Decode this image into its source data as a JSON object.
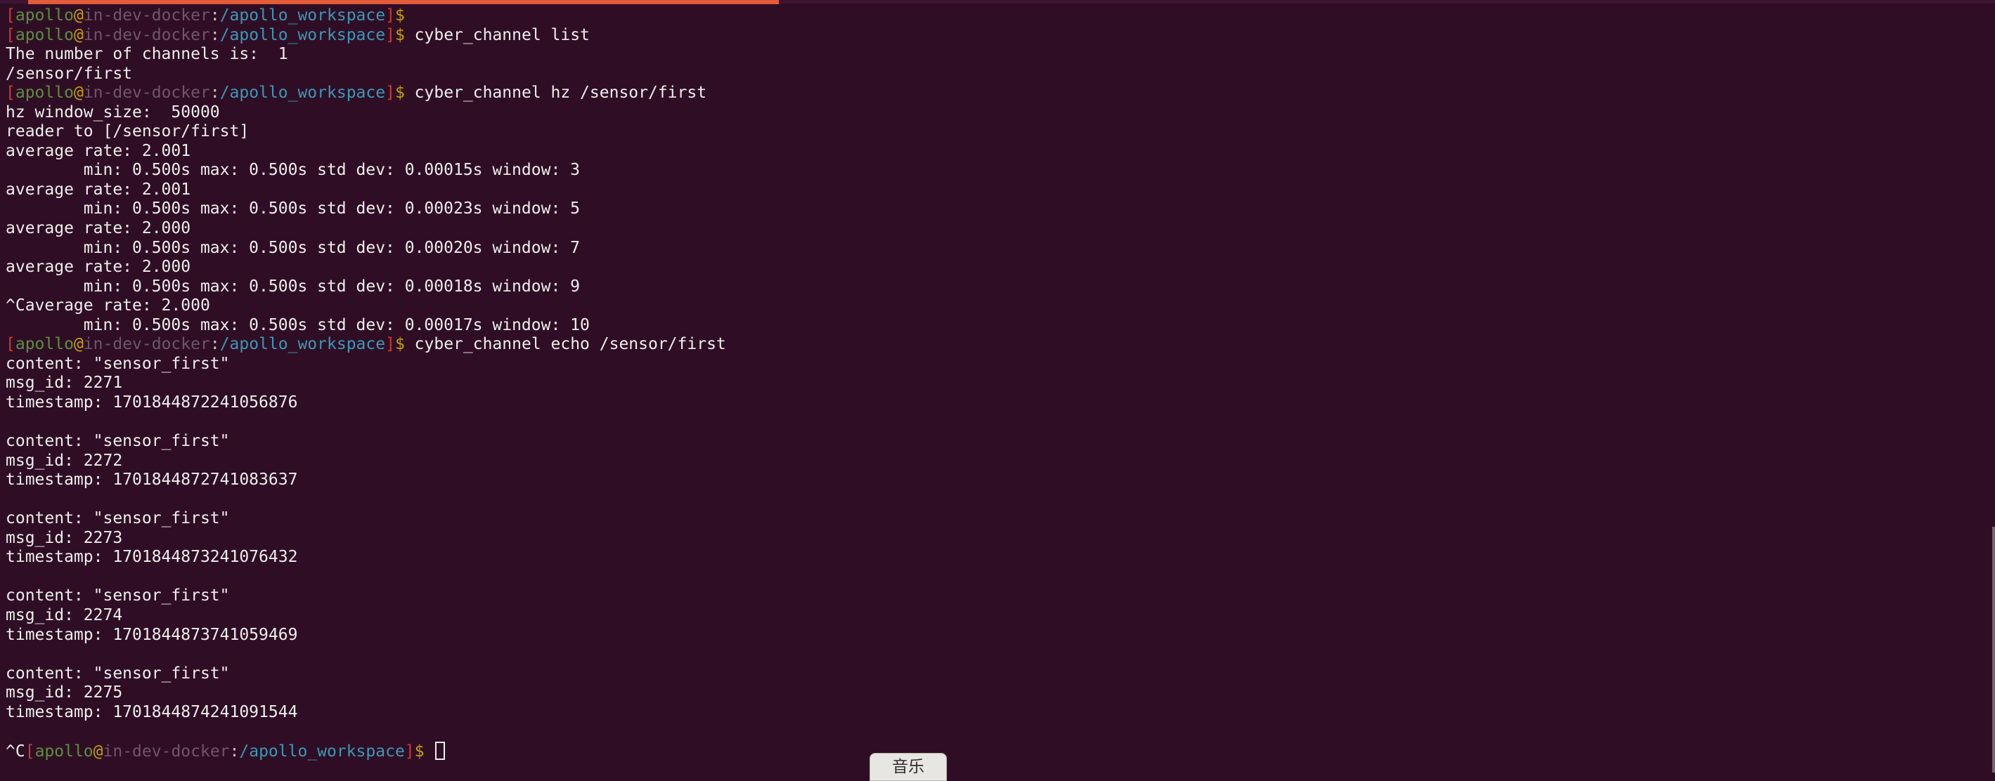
{
  "prompt": {
    "user": "apollo",
    "at": "@",
    "host": "in-dev-docker",
    "colon": ":",
    "path": "/apollo_workspace",
    "dollar": "$",
    "open_bracket": "[",
    "close_bracket": "]"
  },
  "lines": [
    {
      "type": "prompt",
      "cmd": ""
    },
    {
      "type": "prompt",
      "cmd": "cyber_channel list"
    },
    {
      "type": "out",
      "text": "The number of channels is:  1"
    },
    {
      "type": "out",
      "text": "/sensor/first"
    },
    {
      "type": "prompt",
      "cmd": "cyber_channel hz /sensor/first"
    },
    {
      "type": "out",
      "text": "hz window_size:  50000"
    },
    {
      "type": "out",
      "text": "reader to [/sensor/first]"
    },
    {
      "type": "out",
      "text": "average rate: 2.001"
    },
    {
      "type": "out",
      "text": "        min: 0.500s max: 0.500s std dev: 0.00015s window: 3"
    },
    {
      "type": "out",
      "text": "average rate: 2.001"
    },
    {
      "type": "out",
      "text": "        min: 0.500s max: 0.500s std dev: 0.00023s window: 5"
    },
    {
      "type": "out",
      "text": "average rate: 2.000"
    },
    {
      "type": "out",
      "text": "        min: 0.500s max: 0.500s std dev: 0.00020s window: 7"
    },
    {
      "type": "out",
      "text": "average rate: 2.000"
    },
    {
      "type": "out",
      "text": "        min: 0.500s max: 0.500s std dev: 0.00018s window: 9"
    },
    {
      "type": "out",
      "text": "^Caverage rate: 2.000"
    },
    {
      "type": "out",
      "text": "        min: 0.500s max: 0.500s std dev: 0.00017s window: 10"
    },
    {
      "type": "prompt",
      "cmd": "cyber_channel echo /sensor/first"
    },
    {
      "type": "out",
      "text": "content: \"sensor_first\""
    },
    {
      "type": "out",
      "text": "msg_id: 2271"
    },
    {
      "type": "out",
      "text": "timestamp: 1701844872241056876"
    },
    {
      "type": "blank"
    },
    {
      "type": "out",
      "text": "content: \"sensor_first\""
    },
    {
      "type": "out",
      "text": "msg_id: 2272"
    },
    {
      "type": "out",
      "text": "timestamp: 1701844872741083637"
    },
    {
      "type": "blank"
    },
    {
      "type": "out",
      "text": "content: \"sensor_first\""
    },
    {
      "type": "out",
      "text": "msg_id: 2273"
    },
    {
      "type": "out",
      "text": "timestamp: 1701844873241076432"
    },
    {
      "type": "blank"
    },
    {
      "type": "out",
      "text": "content: \"sensor_first\""
    },
    {
      "type": "out",
      "text": "msg_id: 2274"
    },
    {
      "type": "out",
      "text": "timestamp: 1701844873741059469"
    },
    {
      "type": "blank"
    },
    {
      "type": "out",
      "text": "content: \"sensor_first\""
    },
    {
      "type": "out",
      "text": "msg_id: 2275"
    },
    {
      "type": "out",
      "text": "timestamp: 1701844874241091544"
    },
    {
      "type": "blank"
    },
    {
      "type": "prompt",
      "prefix": "^C",
      "cmd": "",
      "cursor": true
    }
  ],
  "taskbar": {
    "music_label": "音乐"
  },
  "colors": {
    "background": "#2f0e25",
    "text": "#eeeeec",
    "bracket": "#cc3b2f",
    "user": "#5b8f3e",
    "host": "#6e5669",
    "path": "#3a99b7",
    "accent": "#e25b3a"
  }
}
